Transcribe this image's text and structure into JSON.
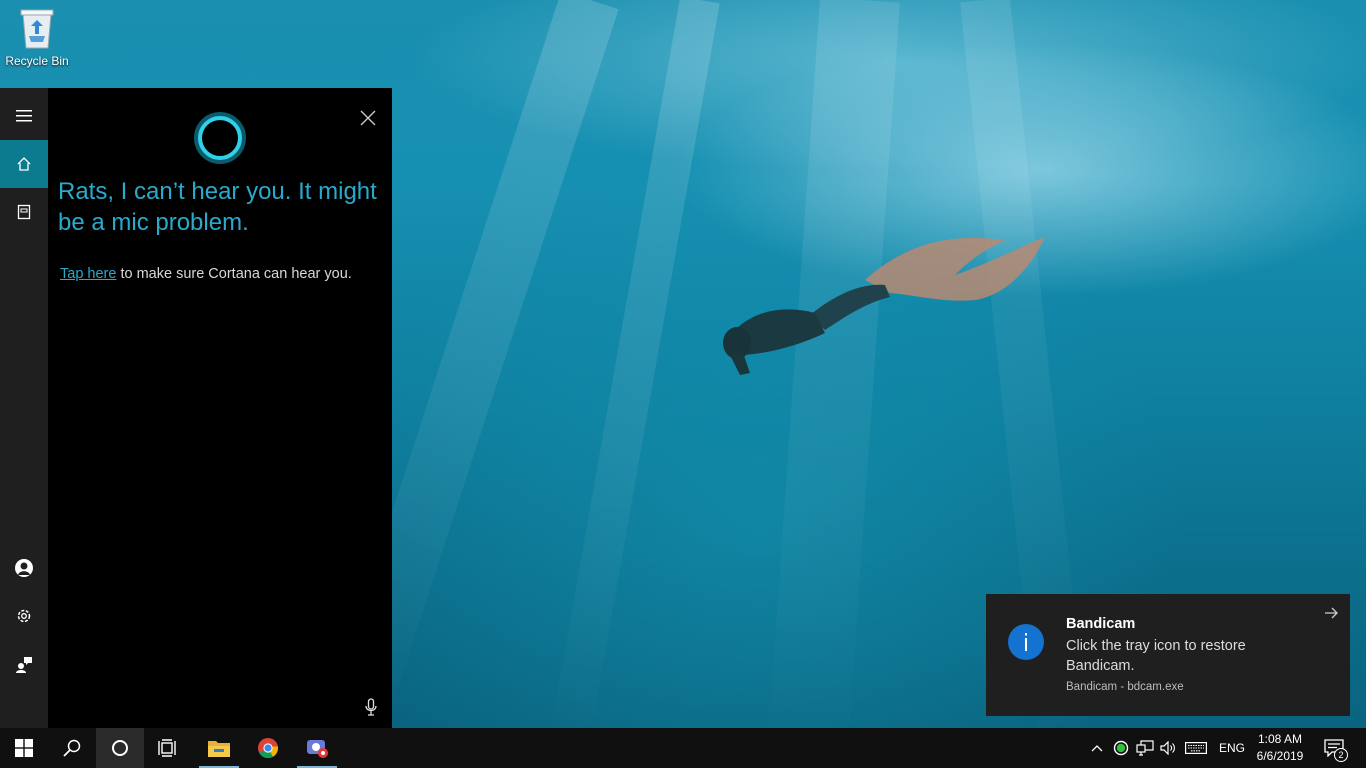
{
  "desktop": {
    "recycle_bin_label": "Recycle Bin"
  },
  "cortana": {
    "heading": "Rats, I can’t hear you. It might be a mic problem.",
    "tip_link": "Tap here",
    "tip_text": " to make sure Cortana can hear you.",
    "accent_color": "#2aaacb",
    "rail_icons": [
      "hamburger-icon",
      "home-icon",
      "notebook-icon",
      "user-icon",
      "gear-icon",
      "feedback-icon"
    ]
  },
  "toast": {
    "title": "Bandicam",
    "body": "Click the tray icon to restore Bandicam.",
    "source": "Bandicam - bdcam.exe",
    "icon": "info-icon"
  },
  "taskbar": {
    "pinned": [
      "start-icon",
      "search-icon",
      "cortana-icon",
      "task-view-icon",
      "file-explorer-icon",
      "chrome-icon",
      "bandicam-icon"
    ],
    "language": "ENG",
    "time": "1:08 AM",
    "date": "6/6/2019",
    "notification_count": "2"
  }
}
